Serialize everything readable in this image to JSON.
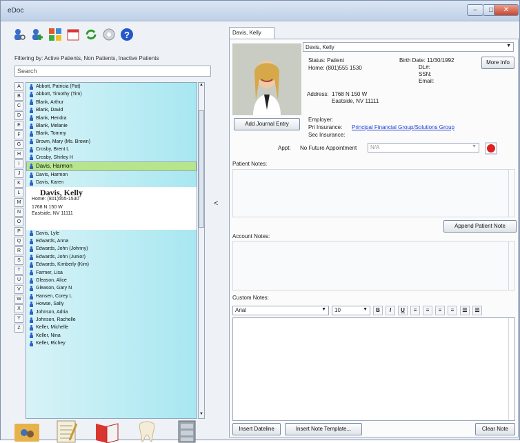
{
  "window": {
    "title": "eDoc"
  },
  "toolbar": {
    "icons": [
      "user-search-icon",
      "add-user-icon",
      "grid-icon",
      "calendar-icon",
      "sync-icon",
      "settings-icon",
      "help-icon"
    ]
  },
  "filter_text": "Filtering by: Active Patients, Non Patients, Inactive Patients",
  "search_value": "Search",
  "alphabet": [
    "A",
    "B",
    "C",
    "D",
    "E",
    "F",
    "G",
    "H",
    "I",
    "J",
    "K",
    "L",
    "M",
    "N",
    "O",
    "P",
    "Q",
    "R",
    "S",
    "T",
    "U",
    "V",
    "W",
    "X",
    "Y",
    "Z"
  ],
  "patients_top": [
    "Abbott, Patricia (Pat)",
    "Abbott, Timothy (Tim)",
    "Blank, Arthur",
    "Blank, David",
    "Blank, Hendra",
    "Blank, Melanie",
    "Blank, Tommy",
    "Brown, Mary (Ms. Brown)",
    "Crosby, Brent L",
    "Crosby, Shirley H",
    "Davis, Harmon",
    "Davis, Harmon",
    "Davis, Karen"
  ],
  "selected_card": {
    "name": "Davis, Kelly",
    "phone": "Home: (801)555-1530",
    "address1": "1768 N 150 W",
    "address2": "Eastside, NV 11111"
  },
  "patients_bottom": [
    "Davis, Lyle",
    "Edwards, Anna",
    "Edwards, John (Johnny)",
    "Edwards, John (Junior)",
    "Edwards, Kimberly (Kim)",
    "Farmer, Lisa",
    "Gleason, Alice",
    "Gleason, Gary N",
    "Hansen, Corey L",
    "Howse, Sally",
    "Johnson, Adria",
    "Johnson, Rachelle",
    "Keller, Michelle",
    "Keller, Nina",
    "Keller, Richey"
  ],
  "tab": {
    "label": "Davis, Kelly"
  },
  "detail": {
    "name": "Davis, Kelly",
    "status": "Status:  Patient",
    "home": "Home: (801)555 1530",
    "birth": "Birth Date: 11/30/1992",
    "dl": "DL#:",
    "ssn": "SSN:",
    "email": "Email:",
    "address_label": "Address:",
    "address1": "1768 N 150 W",
    "address2": "Eastside, NV 11111",
    "employer": "Employer:",
    "pri_ins_label": "Pri Insurance:",
    "pri_ins_value": "Principal Financial Group/Solutions Group",
    "sec_ins_label": "Sec Insurance:",
    "appt_label": "Appt:",
    "appt_value": "No Future Appointment",
    "appt_combo": "N/A"
  },
  "buttons": {
    "more_info": "More Info",
    "add_journal": "Add Journal Entry",
    "append_note": "Append Patient Note",
    "insert_dateline": "Insert Dateline",
    "insert_template": "Insert Note Template...",
    "clear_note": "Clear Note"
  },
  "labels": {
    "patient_notes": "Patient Notes:",
    "account_notes": "Account Notes:",
    "custom_notes": "Custom Notes:"
  },
  "format": {
    "font": "Arial",
    "size": "10",
    "buttons": [
      "B",
      "I",
      "U"
    ]
  },
  "bottom_icons": [
    "contacts-folder-icon",
    "notepad-icon",
    "book-icon",
    "tooth-icon",
    "file-cabinet-icon"
  ]
}
